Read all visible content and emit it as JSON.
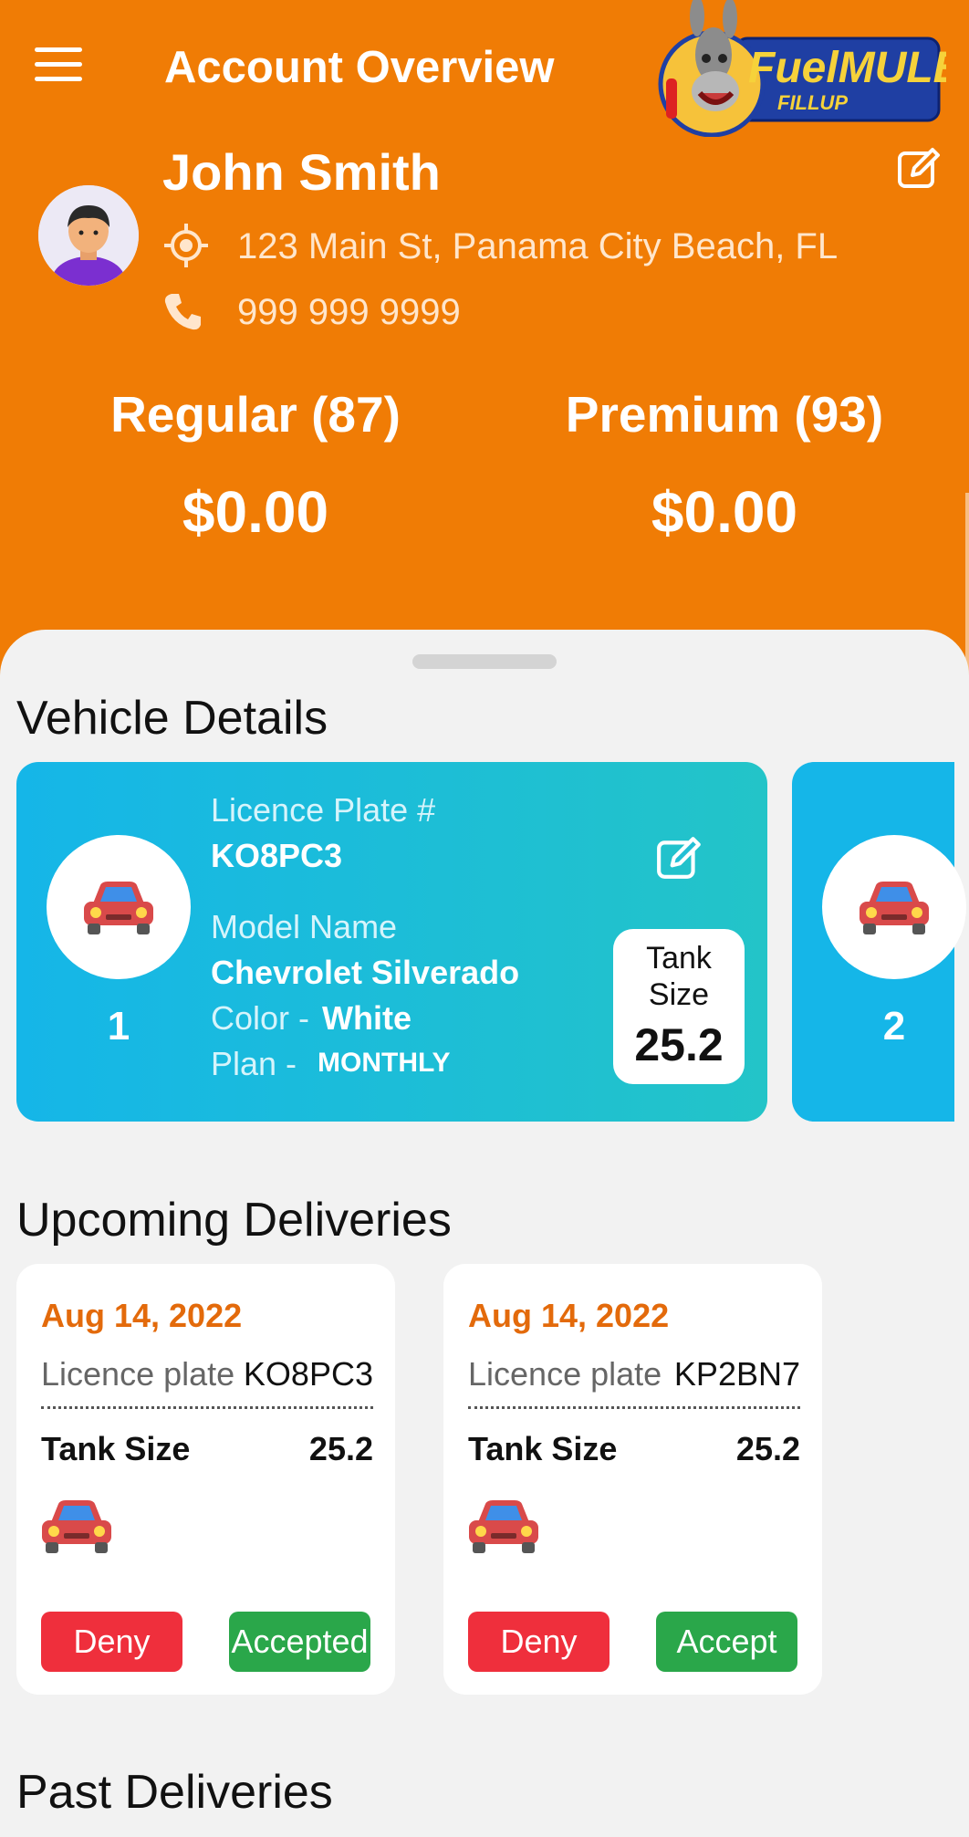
{
  "header": {
    "title": "Account Overview",
    "logo_text_main": "FuelMULE",
    "logo_text_sub": "FILLUP",
    "user_name": "John Smith",
    "address": "123 Main St,  Panama City Beach, FL",
    "phone": "999 999 9999"
  },
  "fuel_prices": [
    {
      "name": "Regular (87)",
      "price": "$0.00"
    },
    {
      "name": "Premium (93)",
      "price": "$0.00"
    }
  ],
  "vehicle_section": {
    "title": "Vehicle Details",
    "vehicles": [
      {
        "number": "1",
        "plate_label": "Licence Plate #",
        "plate": "KO8PC3",
        "model_label": "Model Name",
        "model": "Chevrolet Silverado",
        "color_label": "Color -",
        "color": "White",
        "plan_label": "Plan -",
        "plan": "MONTHLY",
        "tank_label_1": "Tank",
        "tank_label_2": "Size",
        "tank_size": "25.2"
      },
      {
        "number": "2"
      }
    ]
  },
  "upcoming_section": {
    "title": "Upcoming Deliveries",
    "deliveries": [
      {
        "date": "Aug 14, 2022",
        "plate_label": "Licence plate",
        "plate": "KO8PC3",
        "tank_label": "Tank Size",
        "tank": "25.2",
        "deny_label": "Deny",
        "accept_label": "Accepted"
      },
      {
        "date": "Aug 14, 2022",
        "plate_label": "Licence plate",
        "plate": "KP2BN7",
        "tank_label": "Tank Size",
        "tank": "25.2",
        "deny_label": "Deny",
        "accept_label": "Accept"
      }
    ]
  },
  "past_section": {
    "title": "Past Deliveries"
  },
  "colors": {
    "header_bg": "#f07c05",
    "vehicle_card": "#15b6e8",
    "date_orange": "#e36a0b",
    "deny_red": "#ef2f3c",
    "accept_green": "#2aa74a"
  },
  "icons": [
    "menu-icon",
    "edit-icon",
    "location-icon",
    "phone-icon",
    "car-icon"
  ]
}
